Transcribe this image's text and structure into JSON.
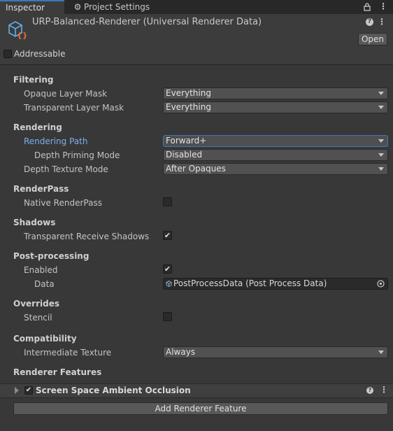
{
  "tabs": {
    "inspector": "Inspector",
    "project_settings": "Project Settings"
  },
  "window_icons": {
    "lock": "lock-icon",
    "menu": "kebab-menu-icon"
  },
  "header": {
    "title": "URP-Balanced-Renderer (Universal Renderer Data)",
    "open_button": "Open",
    "addressable_label": "Addressable",
    "addressable_checked": false
  },
  "filtering": {
    "section": "Filtering",
    "opaque_label": "Opaque Layer Mask",
    "opaque_value": "Everything",
    "transparent_label": "Transparent Layer Mask",
    "transparent_value": "Everything"
  },
  "rendering": {
    "section": "Rendering",
    "path_label": "Rendering Path",
    "path_value": "Forward+",
    "depth_priming_label": "Depth Priming Mode",
    "depth_priming_value": "Disabled",
    "depth_texture_label": "Depth Texture Mode",
    "depth_texture_value": "After Opaques"
  },
  "renderpass": {
    "section": "RenderPass",
    "native_label": "Native RenderPass",
    "native_checked": false
  },
  "shadows": {
    "section": "Shadows",
    "receive_label": "Transparent Receive Shadows",
    "receive_checked": true
  },
  "postprocessing": {
    "section": "Post-processing",
    "enabled_label": "Enabled",
    "enabled_checked": true,
    "data_label": "Data",
    "data_value": "PostProcessData (Post Process Data)"
  },
  "overrides": {
    "section": "Overrides",
    "stencil_label": "Stencil",
    "stencil_checked": false
  },
  "compatibility": {
    "section": "Compatibility",
    "intermediate_label": "Intermediate Texture",
    "intermediate_value": "Always"
  },
  "renderer_features": {
    "section": "Renderer Features",
    "feature_name": "Screen Space Ambient Occlusion",
    "feature_enabled": true,
    "add_button": "Add Renderer Feature"
  },
  "colors": {
    "background": "#383838",
    "accent": "#3a79bb",
    "active_label": "#7bb0f0"
  }
}
